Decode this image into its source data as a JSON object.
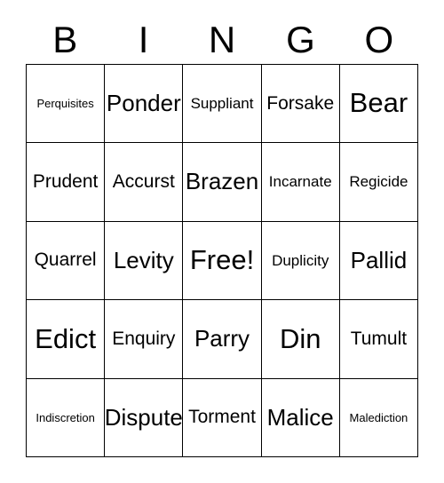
{
  "card": {
    "header_letters": [
      "B",
      "I",
      "N",
      "G",
      "O"
    ],
    "free_space_label": "Free!",
    "colors": {
      "border": "#000000",
      "text": "#000000",
      "background": "#ffffff"
    },
    "rows": [
      [
        {
          "label": "Perquisites",
          "size": "s-xs"
        },
        {
          "label": "Ponder",
          "size": "s-lg"
        },
        {
          "label": "Suppliant",
          "size": "s-sm"
        },
        {
          "label": "Forsake",
          "size": "s-md"
        },
        {
          "label": "Bear",
          "size": "s-xl"
        }
      ],
      [
        {
          "label": "Prudent",
          "size": "s-md"
        },
        {
          "label": "Accurst",
          "size": "s-md"
        },
        {
          "label": "Brazen",
          "size": "s-lg"
        },
        {
          "label": "Incarnate",
          "size": "s-sm"
        },
        {
          "label": "Regicide",
          "size": "s-sm"
        }
      ],
      [
        {
          "label": "Quarrel",
          "size": "s-md"
        },
        {
          "label": "Levity",
          "size": "s-lg"
        },
        {
          "label": "Free!",
          "size": "s-xl"
        },
        {
          "label": "Duplicity",
          "size": "s-sm"
        },
        {
          "label": "Pallid",
          "size": "s-lg"
        }
      ],
      [
        {
          "label": "Edict",
          "size": "s-xl"
        },
        {
          "label": "Enquiry",
          "size": "s-md"
        },
        {
          "label": "Parry",
          "size": "s-lg"
        },
        {
          "label": "Din",
          "size": "s-xl"
        },
        {
          "label": "Tumult",
          "size": "s-md"
        }
      ],
      [
        {
          "label": "Indiscretion",
          "size": "s-xs"
        },
        {
          "label": "Dispute",
          "size": "s-lg"
        },
        {
          "label": "Torment",
          "size": "s-md"
        },
        {
          "label": "Malice",
          "size": "s-lg"
        },
        {
          "label": "Malediction",
          "size": "s-xs"
        }
      ]
    ]
  }
}
